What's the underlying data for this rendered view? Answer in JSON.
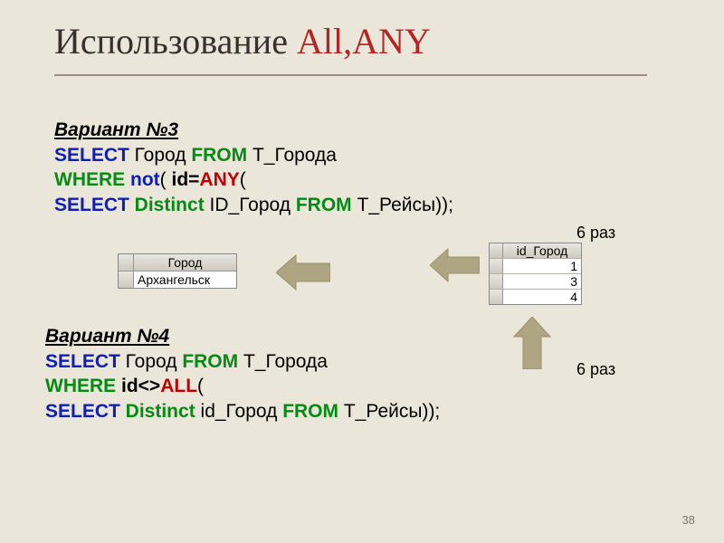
{
  "title": {
    "part1": "Использование ",
    "part2": "All,ANY"
  },
  "variant3": {
    "heading": "Вариант №3",
    "line1": {
      "select": "SELECT",
      "city": " Город  ",
      "from": "FROM",
      "table": " Т_Города"
    },
    "line2": {
      "where": "WHERE",
      "not": "  not",
      "open": "( ",
      "id_eq": "id=",
      "any": "ANY",
      "paren": "("
    },
    "line3": {
      "select": "SELECT",
      "distinct": " Distinct",
      "idcity": " ID_Город ",
      "from": "FROM",
      "table": " Т_Рейсы));"
    }
  },
  "variant4": {
    "heading": "Вариант №4",
    "line1": {
      "select": "SELECT",
      "city": " Город  ",
      "from": "FROM",
      "table": " Т_Города"
    },
    "line2": {
      "leading": " ",
      "where": "WHERE",
      "id": "   id<>",
      "all": "ALL",
      "paren": "("
    },
    "line3": {
      "leading": "  ",
      "select": "SELECT",
      "distinct": " Distinct",
      "idcity": " id_Город ",
      "from": "FROM",
      "table": " Т_Рейсы));"
    }
  },
  "table1": {
    "header": "Город",
    "rows": [
      "Архангельск"
    ]
  },
  "table2": {
    "header": "id_Город",
    "rows": [
      "1",
      "3",
      "4"
    ]
  },
  "labels": {
    "six1": "6 раз",
    "six2": "6 раз"
  },
  "page": "38",
  "chart_data": {
    "type": "table",
    "tables": [
      {
        "columns": [
          "Город"
        ],
        "rows": [
          [
            "Архангельск"
          ]
        ]
      },
      {
        "columns": [
          "id_Город"
        ],
        "rows": [
          [
            "1"
          ],
          [
            "3"
          ],
          [
            "4"
          ]
        ]
      }
    ]
  }
}
